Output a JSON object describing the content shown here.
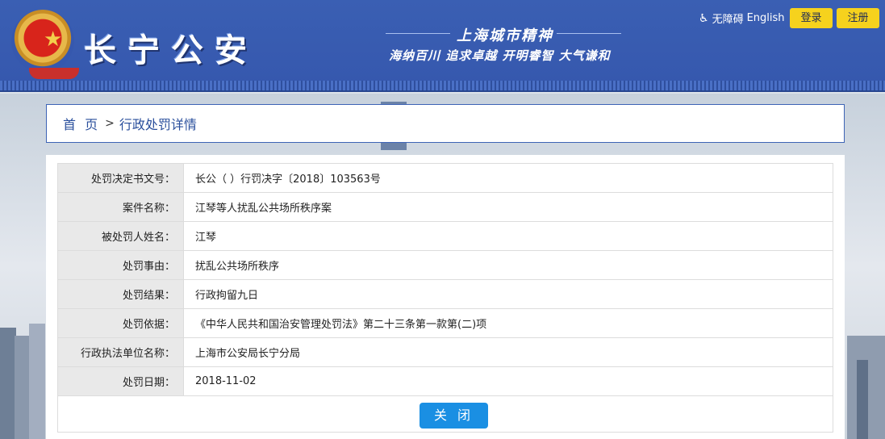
{
  "header": {
    "site_title": "长宁公安",
    "spirit_title": "上海城市精神",
    "spirit_motto": "海纳百川 追求卓越 开明睿智 大气谦和",
    "accessibility_label": "无障碍",
    "language_label": "English",
    "login_label": "登录",
    "register_label": "注册"
  },
  "breadcrumb": {
    "home": "首 页",
    "separator": ">",
    "current": "行政处罚详情"
  },
  "detail": {
    "rows": [
      {
        "label": "处罚决定书文号：",
        "value": "长公（ ）行罚决字〔2018〕103563号"
      },
      {
        "label": "案件名称：",
        "value": "江琴等人扰乱公共场所秩序案"
      },
      {
        "label": "被处罚人姓名：",
        "value": "江琴"
      },
      {
        "label": "处罚事由：",
        "value": "扰乱公共场所秩序"
      },
      {
        "label": "处罚结果：",
        "value": "行政拘留九日"
      },
      {
        "label": "处罚依据：",
        "value": "《中华人民共和国治安管理处罚法》第二十三条第一款第(二)项"
      },
      {
        "label": "行政执法单位名称：",
        "value": "上海市公安局长宁分局"
      },
      {
        "label": "处罚日期：",
        "value": "2018-11-02"
      }
    ],
    "close_label": "关 闭"
  },
  "colors": {
    "header_blue": "#3658ae",
    "button_yellow": "#f6d21d",
    "close_blue": "#1a8fe3"
  }
}
